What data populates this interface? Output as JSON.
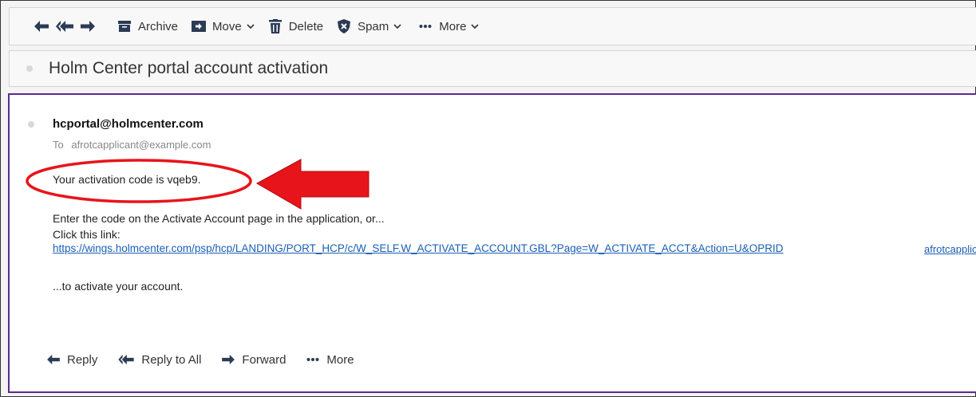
{
  "toolbar": {
    "nav": [
      {
        "icon": "reply-arrow-icon"
      },
      {
        "icon": "reply-all-arrow-icon"
      },
      {
        "icon": "forward-arrow-icon"
      }
    ],
    "archive_label": "Archive",
    "move_label": "Move",
    "delete_label": "Delete",
    "spam_label": "Spam",
    "more_label": "More"
  },
  "subject": "Holm Center portal account activation",
  "message": {
    "sender": "hcportal@holmcenter.com",
    "to_label": "To",
    "to_address": "afrotcapplicant@example.com",
    "lines": {
      "activation": "Your activation code is vqeb9.",
      "enter_code": "Enter the code on the Activate Account page in the application, or...",
      "click_link": "Click this link:",
      "to_activate": "...to activate your account."
    },
    "link_url": "https://wings.holmcenter.com/psp/hcp/LANDING/PORT_HCP/c/W_SELF.W_ACTIVATE_ACCOUNT.GBL?Page=W_ACTIVATE_ACCT&Action=U&OPRID",
    "link_user": "afrotcapplicant"
  },
  "actions": {
    "reply_label": "Reply",
    "reply_all_label": "Reply to All",
    "forward_label": "Forward",
    "more_label": "More"
  },
  "annotation": {
    "highlight_color": "#e8141b"
  }
}
